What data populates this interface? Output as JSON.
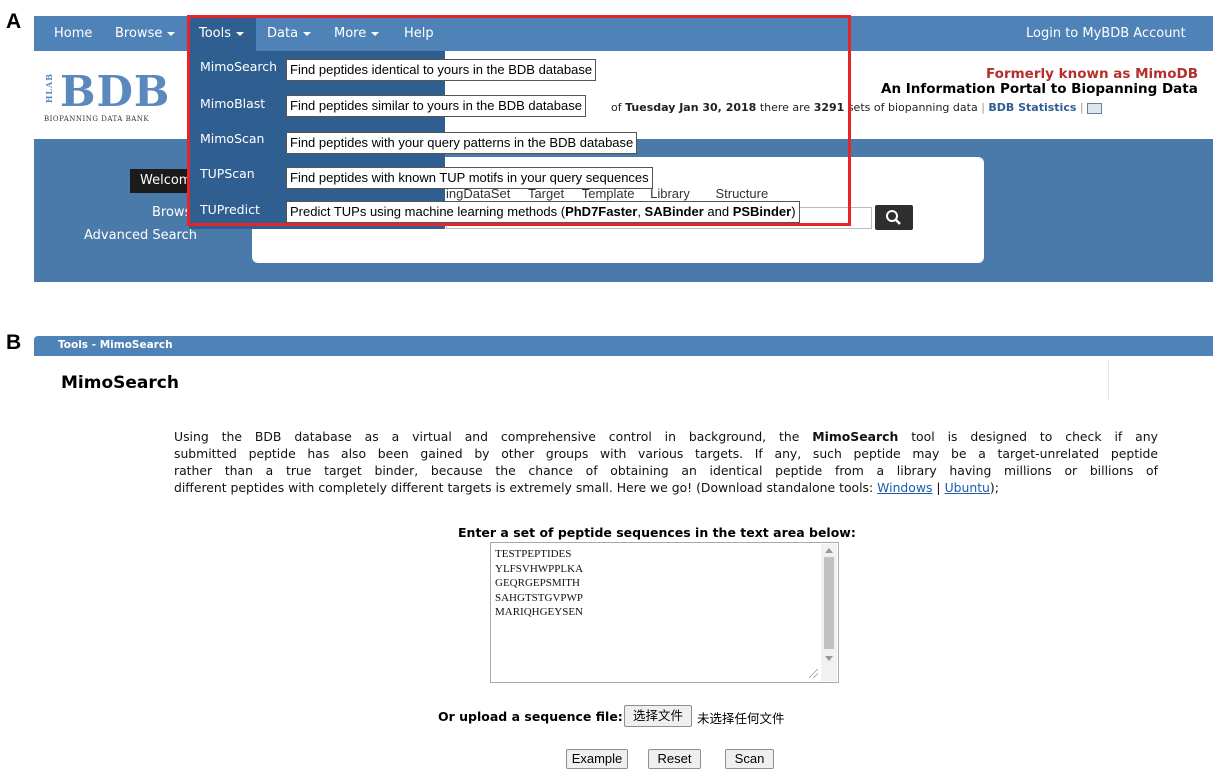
{
  "panel_a": {
    "label": "A",
    "navbar": {
      "items": [
        {
          "label": "Home",
          "has_caret": false
        },
        {
          "label": "Browse",
          "has_caret": true
        },
        {
          "label": "Tools",
          "has_caret": true
        },
        {
          "label": "Data",
          "has_caret": true
        },
        {
          "label": "More",
          "has_caret": true
        },
        {
          "label": "Help",
          "has_caret": false
        }
      ],
      "login": "Login to MyBDB Account"
    },
    "logo": {
      "text": "BDB",
      "side": "HLAB",
      "subtitle": "BIOPANNING DATA BANK"
    },
    "header": {
      "formerly": "Formerly known as MimoDB",
      "portal": "An Information Portal to Biopanning Data",
      "stats_prefix": "of",
      "stats_date": "Tuesday Jan 30, 2018",
      "stats_mid": "there are",
      "stats_count": "3291",
      "stats_suffix": "sets of biopanning data",
      "stats_link": "BDB Statistics"
    },
    "tools_menu": [
      {
        "name": "MimoSearch",
        "desc": "Find peptides identical to yours in the BDB database"
      },
      {
        "name": "MimoBlast",
        "desc": "Find peptides similar to yours in the BDB database"
      },
      {
        "name": "MimoScan",
        "desc": "Find peptides with your query patterns in the BDB database"
      },
      {
        "name": "TUPScan",
        "desc": "Find peptides with known TUP motifs in your query sequences"
      },
      {
        "name": "TUPredict",
        "desc_prefix": "Predict TUPs using machine learning methods (",
        "b1": "PhD7Faster",
        "sep1": ", ",
        "b2": "SABinder",
        "sep2": " and ",
        "b3": "PSBinder",
        "desc_suffix": ")"
      }
    ],
    "search_area": {
      "welcome": "Welcom",
      "browse": "Brows",
      "advanced": "Advanced Search",
      "tabs_partial": "ingDataSet",
      "tab_target": "Target",
      "tab_template": "Template",
      "tab_library": "Library",
      "tab_structure": "Structure"
    }
  },
  "panel_b": {
    "label": "B",
    "breadcrumb": "Tools - MimoSearch",
    "title": "MimoSearch",
    "desc_1": "Using the BDB database as a virtual and comprehensive control in background, the",
    "desc_bold": "MimoSearch",
    "desc_2": "tool is designed to check if any",
    "desc_line2": "submitted peptide has also been gained by other groups with various targets. If any, such peptide may be a target-unrelated peptide",
    "desc_line3": "rather than a true target binder, because the chance of obtaining an identical peptide from a library having millions or billions of",
    "desc_line4": "different peptides with completely different targets is extremely small. Here we go! (Download standalone tools:",
    "link_windows": "Windows",
    "link_sep": "|",
    "link_ubuntu": "Ubuntu",
    "desc_end": ");",
    "enter_label": "Enter a set of peptide sequences in the text area below:",
    "sequences": [
      "TESTPEPTIDES",
      "YLFSVHWPPLKA",
      "GEQRGEPSMITH",
      "SAHGTSTGVPWP",
      "MARIQHGEYSEN"
    ],
    "upload_label": "Or upload a sequence file:",
    "choose_file": "选择文件",
    "no_file": "未选择任何文件",
    "btn_example": "Example",
    "btn_reset": "Reset",
    "btn_scan": "Scan"
  }
}
